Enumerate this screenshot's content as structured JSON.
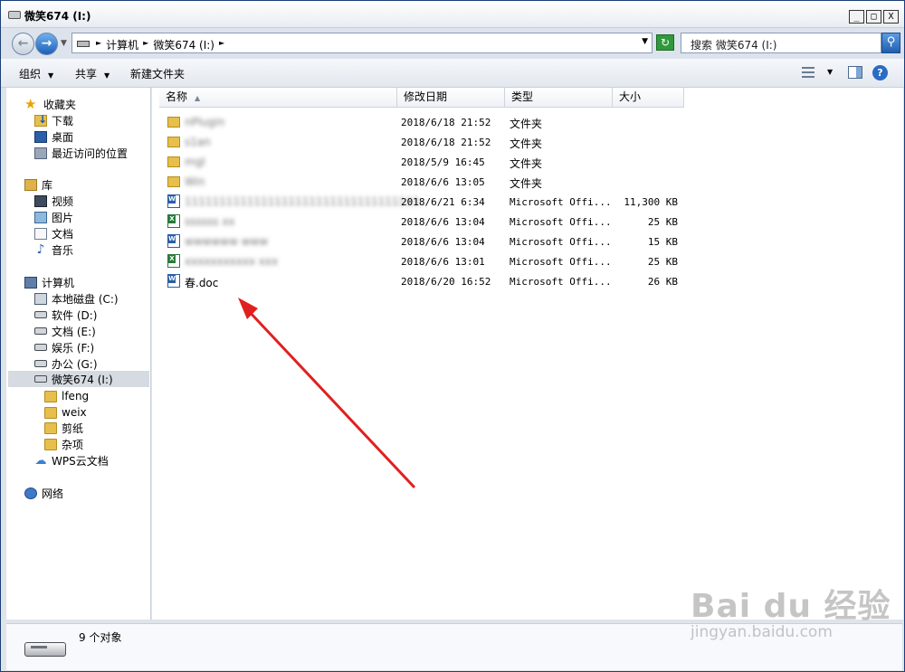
{
  "window": {
    "title": "微笑674 (I:)",
    "controls": [
      "_",
      "□",
      "X"
    ]
  },
  "address": {
    "crumbs": [
      "计算机",
      "微笑674 (I:)"
    ],
    "search_placeholder": "搜索 微笑674 (I:)"
  },
  "toolbar": {
    "organize": "组织",
    "share": "共享",
    "new_folder": "新建文件夹"
  },
  "sidebar": {
    "favorites": {
      "label": "收藏夹",
      "items": [
        "下载",
        "桌面",
        "最近访问的位置"
      ]
    },
    "libraries": {
      "label": "库",
      "items": [
        "视频",
        "图片",
        "文档",
        "音乐"
      ]
    },
    "computer": {
      "label": "计算机",
      "drives": [
        "本地磁盘 (C:)",
        "软件 (D:)",
        "文档 (E:)",
        "娱乐 (F:)",
        "办公 (G:)",
        "微笑674 (I:)"
      ],
      "subfolders": [
        "lfeng",
        "weix",
        "剪纸",
        "杂项"
      ]
    },
    "wps_cloud": "WPS云文档",
    "network": "网络"
  },
  "columns": {
    "name": "名称",
    "date": "修改日期",
    "type": "类型",
    "size": "大小"
  },
  "files": [
    {
      "icon": "folder-icon",
      "name": "nPlugin",
      "date": "2018/6/18 21:52",
      "type": "文件夹",
      "size": "",
      "blurred": true
    },
    {
      "icon": "folder-icon",
      "name": "s1an",
      "date": "2018/6/18 21:52",
      "type": "文件夹",
      "size": "",
      "blurred": true
    },
    {
      "icon": "folder-icon",
      "name": "mgl",
      "date": "2018/5/9 16:45",
      "type": "文件夹",
      "size": "",
      "blurred": true
    },
    {
      "icon": "folder-icon",
      "name": "Win",
      "date": "2018/6/6 13:05",
      "type": "文件夹",
      "size": "",
      "blurred": true
    },
    {
      "icon": "word-doc-icon",
      "name": "1111111111111111111111111111111111",
      "date": "2018/6/21 6:34",
      "type": "Microsoft Offi...",
      "size": "11,300 KB",
      "blurred": true
    },
    {
      "icon": "excel-doc-icon",
      "name": "ssssss xx",
      "date": "2018/6/6 13:04",
      "type": "Microsoft Offi...",
      "size": "25 KB",
      "blurred": true
    },
    {
      "icon": "word-doc-icon",
      "name": "wwwwww www",
      "date": "2018/6/6 13:04",
      "type": "Microsoft Offi...",
      "size": "15 KB",
      "blurred": true
    },
    {
      "icon": "excel-doc-icon",
      "name": "xxxxxxxxxxx xxx",
      "date": "2018/6/6 13:01",
      "type": "Microsoft Offi...",
      "size": "25 KB",
      "blurred": true
    },
    {
      "icon": "word-doc-icon",
      "name": "春.doc",
      "date": "2018/6/20 16:52",
      "type": "Microsoft Offi...",
      "size": "26 KB",
      "blurred": false
    }
  ],
  "status": {
    "count": "9 个对象"
  },
  "watermark": {
    "main": "Bai du 经验",
    "sub": "jingyan.baidu.com"
  },
  "colors": {
    "arrow": "#e02020",
    "selection": "#d6dbe2",
    "title_bar_bottom": "#e8ecf2"
  }
}
